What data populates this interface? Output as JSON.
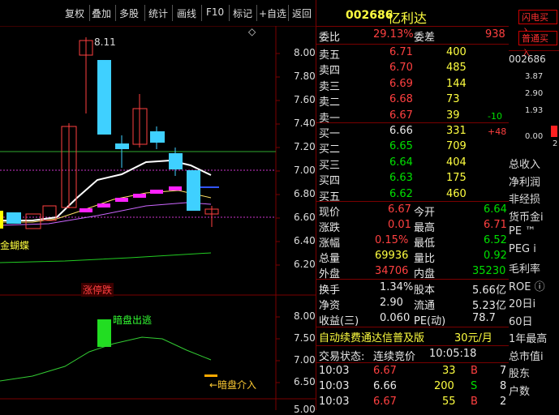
{
  "toolbar": {
    "items": [
      "复权",
      "叠加",
      "多股",
      "统计",
      "画线",
      "F10",
      "标记",
      "+自选",
      "返回"
    ]
  },
  "chart": {
    "price_axis": [
      "8.00",
      "7.80",
      "7.60",
      "7.40",
      "7.20",
      "7.00",
      "6.80",
      "6.60",
      "6.40",
      "6.20"
    ],
    "indicator_axis": [
      "8.00",
      "7.50",
      "7.00",
      "6.50"
    ],
    "bottom_axis_partial": "5.00",
    "high_label": "8.11",
    "label_butterfly": "金蝴蝶",
    "label_limit_drop": "涨停跌",
    "label_dark_exit": "暗盘出逃",
    "label_dark_enter": "←暗盘介入",
    "corner_icon": "◇"
  },
  "quote": {
    "code": "002686",
    "name": "亿利达",
    "weibi_label": "委比",
    "weibi_value": "29.13%",
    "weicha_label": "委差",
    "weicha_value": "938",
    "asks": [
      {
        "label": "卖五",
        "price": "6.71",
        "vol": "400",
        "chg": ""
      },
      {
        "label": "卖四",
        "price": "6.70",
        "vol": "485",
        "chg": ""
      },
      {
        "label": "卖三",
        "price": "6.69",
        "vol": "144",
        "chg": ""
      },
      {
        "label": "卖二",
        "price": "6.68",
        "vol": "73",
        "chg": ""
      },
      {
        "label": "卖一",
        "price": "6.67",
        "vol": "39",
        "chg": "-10"
      }
    ],
    "bids": [
      {
        "label": "买一",
        "price": "6.66",
        "vol": "331",
        "chg": "+48"
      },
      {
        "label": "买二",
        "price": "6.65",
        "vol": "709",
        "chg": ""
      },
      {
        "label": "买三",
        "price": "6.64",
        "vol": "404",
        "chg": ""
      },
      {
        "label": "买四",
        "price": "6.63",
        "vol": "175",
        "chg": ""
      },
      {
        "label": "买五",
        "price": "6.62",
        "vol": "460",
        "chg": ""
      }
    ],
    "stats": [
      {
        "l1": "现价",
        "v1": "6.67",
        "c1": "red",
        "l2": "今开",
        "v2": "6.64",
        "c2": "green"
      },
      {
        "l1": "涨跌",
        "v1": "0.01",
        "c1": "red",
        "l2": "最高",
        "v2": "6.71",
        "c2": "red"
      },
      {
        "l1": "涨幅",
        "v1": "0.15%",
        "c1": "red",
        "l2": "最低",
        "v2": "6.52",
        "c2": "green"
      },
      {
        "l1": "总量",
        "v1": "69936",
        "c1": "yellow",
        "l2": "量比",
        "v2": "0.92",
        "c2": "green"
      },
      {
        "l1": "外盘",
        "v1": "34706",
        "c1": "red",
        "l2": "内盘",
        "v2": "35230",
        "c2": "green"
      }
    ],
    "stats2": [
      {
        "l1": "换手",
        "v1": "1.34%",
        "l2": "股本",
        "v2": "5.66亿"
      },
      {
        "l1": "净资",
        "v1": "2.90",
        "l2": "流通",
        "v2": "5.23亿"
      },
      {
        "l1": "收益(三)",
        "v1": "0.060",
        "l2": "PE(动)",
        "v2": "78.7"
      }
    ],
    "promo": "自动续费通达信普及版",
    "promo_price": "30元/月",
    "status_label": "交易状态:",
    "status_value": "连续竞价",
    "status_time": "10:05:18",
    "ticks": [
      {
        "time": "10:03",
        "price": "6.67",
        "vol": "33",
        "bs": "B",
        "n": "7"
      },
      {
        "time": "10:03",
        "price": "6.66",
        "vol": "200",
        "bs": "S",
        "n": "8"
      },
      {
        "time": "10:03",
        "price": "6.67",
        "vol": "55",
        "bs": "B",
        "n": "2"
      }
    ]
  },
  "side": {
    "btn_flash": "闪电买入",
    "btn_normal": "普通买入",
    "code": "002686",
    "axis": [
      "3.87",
      "2.90",
      "1.93",
      "0.00"
    ],
    "axis_tail": "2",
    "items": [
      "总收入",
      "净利润",
      "非经损",
      "货币金i",
      "PE ™",
      "PEG i",
      "毛利率",
      "ROE ⓘ",
      "20日i",
      "60日",
      "1年最高",
      "总市值i",
      "股东",
      "户数"
    ]
  }
}
